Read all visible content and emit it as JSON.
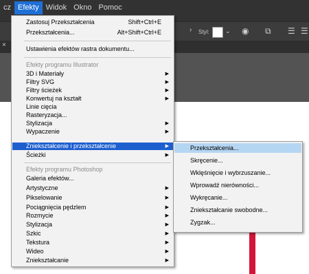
{
  "menubar": [
    {
      "label": "cz",
      "active": false
    },
    {
      "label": "Efekty",
      "active": true
    },
    {
      "label": "Widok",
      "active": false
    },
    {
      "label": "Okno",
      "active": false
    },
    {
      "label": "Pomoc",
      "active": false
    }
  ],
  "toolbar": {
    "style_label": "Styl:",
    "dropdown_arrow": "›",
    "icons": [
      "chevron-right-icon",
      "color-swatch-icon",
      "chevron-down-icon",
      "globe-icon",
      "transform-icon",
      "align-left-icon",
      "align-center-icon"
    ]
  },
  "effects_menu": {
    "items": [
      {
        "label": "Zastosuj Przekształcenia",
        "shortcut": "Shift+Ctrl+E"
      },
      {
        "label": "Przekształcenia...",
        "shortcut": "Alt+Shift+Ctrl+E"
      },
      {
        "label": "Ustawienia efektów rastra dokumentu..."
      },
      {
        "section": "Efekty programu Illustrator"
      },
      {
        "label": "3D i Materiały",
        "sub": true
      },
      {
        "label": "Filtry SVG",
        "sub": true
      },
      {
        "label": "Filtry ścieżek",
        "sub": true
      },
      {
        "label": "Konwertuj na kształt",
        "sub": true
      },
      {
        "label": "Linie cięcia"
      },
      {
        "label": "Rasteryzacja..."
      },
      {
        "label": "Stylizacja",
        "sub": true
      },
      {
        "label": "Wypaczenie",
        "sub": true
      },
      {
        "label": "Zniekształcenie i przekształcenie",
        "sub": true,
        "highlight": true
      },
      {
        "label": "Ścieżki",
        "sub": true
      },
      {
        "section": "Efekty programu Photoshop"
      },
      {
        "label": "Galeria efektów..."
      },
      {
        "label": "Artystyczne",
        "sub": true
      },
      {
        "label": "Pikselowanie",
        "sub": true
      },
      {
        "label": "Pociągnięcia pędzlem",
        "sub": true
      },
      {
        "label": "Rozmycie",
        "sub": true
      },
      {
        "label": "Stylizacja",
        "sub": true
      },
      {
        "label": "Szkic",
        "sub": true
      },
      {
        "label": "Tekstura",
        "sub": true
      },
      {
        "label": "Wideo",
        "sub": true
      },
      {
        "label": "Zniekształcanie",
        "sub": true
      }
    ]
  },
  "submenu": {
    "items": [
      {
        "label": "Przekształcenia...",
        "highlight": true
      },
      {
        "label": "Skręcenie..."
      },
      {
        "label": "Wklęśnięcie i wybrzuszanie..."
      },
      {
        "label": "Wprowadź nierówności..."
      },
      {
        "label": "Wykręcanie..."
      },
      {
        "label": "Zniekształcanie swobodne..."
      },
      {
        "label": "Zygzak..."
      }
    ]
  },
  "colors": {
    "menubar_bg": "#323232",
    "highlight": "#1e5fd0",
    "submenu_highlight": "#b5d6f3",
    "canvas_object": "#d2163a"
  }
}
